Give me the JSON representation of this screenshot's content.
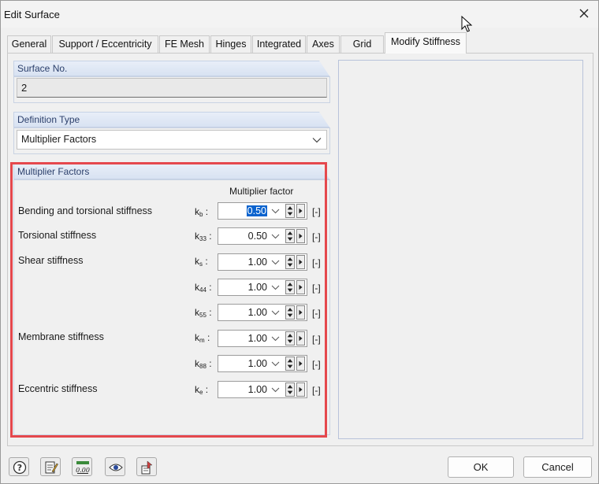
{
  "window": {
    "title": "Edit Surface"
  },
  "tabs": [
    {
      "label": "General"
    },
    {
      "label": "Support / Eccentricity"
    },
    {
      "label": "FE Mesh"
    },
    {
      "label": "Hinges"
    },
    {
      "label": "Integrated"
    },
    {
      "label": "Axes"
    },
    {
      "label": "Grid"
    },
    {
      "label": "Modify Stiffness"
    }
  ],
  "active_tab": "Modify Stiffness",
  "surface_no": {
    "label": "Surface No.",
    "value": "2"
  },
  "definition_type": {
    "label": "Definition Type",
    "value": "Multiplier Factors"
  },
  "multiplier_factors": {
    "label": "Multiplier Factors",
    "column_header": "Multiplier factor",
    "unit": "[-]",
    "rows": [
      {
        "label": "Bending and torsional stiffness",
        "symbol": "k",
        "sub": "b",
        "value": "0.50"
      },
      {
        "label": "Torsional stiffness",
        "symbol": "k",
        "sub": "33",
        "value": "0.50"
      },
      {
        "label": "Shear stiffness",
        "symbol": "k",
        "sub": "s",
        "value": "1.00"
      },
      {
        "label": "",
        "symbol": "k",
        "sub": "44",
        "value": "1.00"
      },
      {
        "label": "",
        "symbol": "k",
        "sub": "55",
        "value": "1.00"
      },
      {
        "label": "Membrane stiffness",
        "symbol": "k",
        "sub": "m",
        "value": "1.00"
      },
      {
        "label": "",
        "symbol": "k",
        "sub": "88",
        "value": "1.00"
      },
      {
        "label": "Eccentric stiffness",
        "symbol": "k",
        "sub": "e",
        "value": "1.00"
      }
    ]
  },
  "buttons": {
    "ok": "OK",
    "cancel": "Cancel"
  },
  "bottom_icons": [
    "help-icon",
    "edit-icon",
    "units-icon",
    "view-icon",
    "export-icon"
  ],
  "colors": {
    "highlight": "#e5484d",
    "group_header": "#dde6f4",
    "selection": "#0b63ce"
  }
}
